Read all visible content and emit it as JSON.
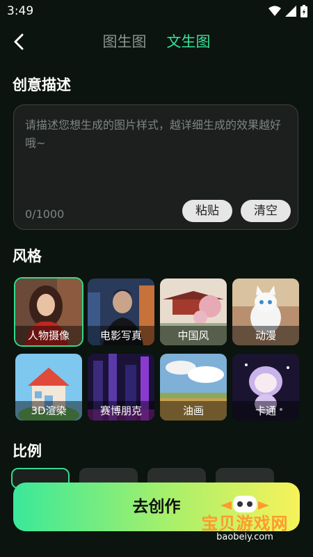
{
  "status": {
    "time": "3:49"
  },
  "header": {
    "tabs": [
      {
        "label": "图生图",
        "active": false
      },
      {
        "label": "文生图",
        "active": true
      }
    ]
  },
  "description": {
    "title": "创意描述",
    "placeholder": "请描述您想生成的图片样式，越详细生成的效果越好哦~",
    "counter": "0/1000",
    "paste_label": "粘贴",
    "clear_label": "清空"
  },
  "style": {
    "title": "风格",
    "items": [
      {
        "label": "人物摄像",
        "selected": true
      },
      {
        "label": "电影写真",
        "selected": false
      },
      {
        "label": "中国风",
        "selected": false
      },
      {
        "label": "动漫",
        "selected": false
      },
      {
        "label": "3D渲染",
        "selected": false
      },
      {
        "label": "赛博朋克",
        "selected": false
      },
      {
        "label": "油画",
        "selected": false
      },
      {
        "label": "卡通",
        "selected": false
      }
    ]
  },
  "ratio": {
    "title": "比例"
  },
  "create_label": "去创作",
  "watermark": {
    "text": "宝贝游戏网",
    "url": "baobeiy.com"
  },
  "colors": {
    "accent": "#38e39a",
    "background": "#0b140f"
  }
}
